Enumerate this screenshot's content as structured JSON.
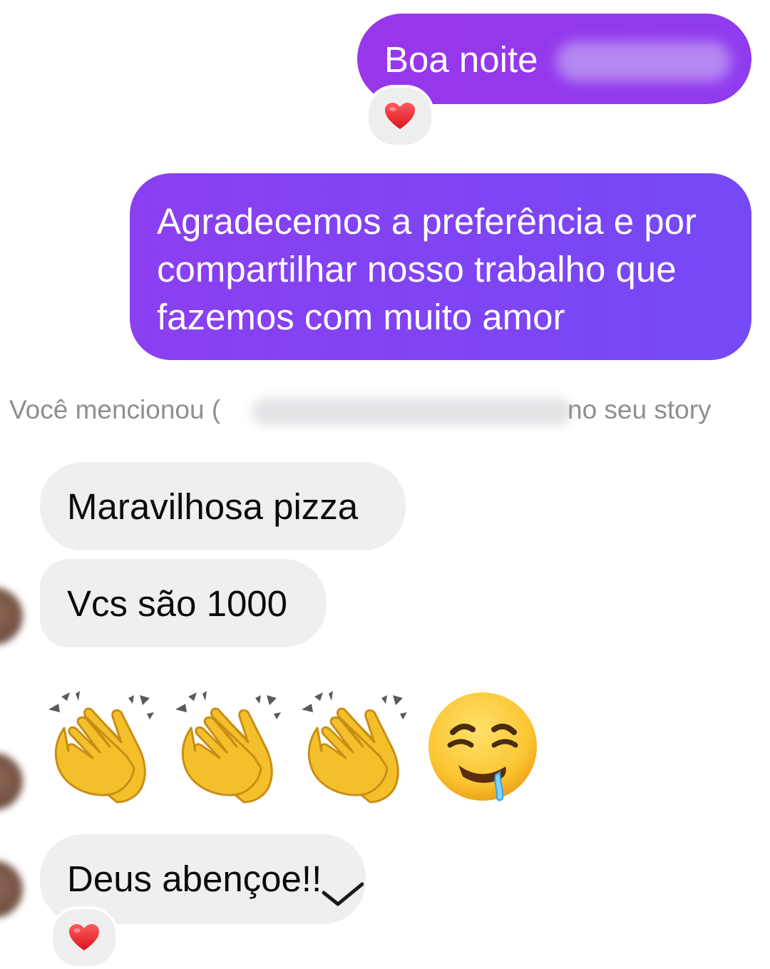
{
  "messages": {
    "outgoing_1": "Boa noite",
    "outgoing_2": "Agradecemos a preferência e por compartilhar nosso trabalho que fazemos com muito amor",
    "mention_prefix": "Você mencionou (",
    "mention_suffix": "no seu story",
    "incoming_1": "Maravilhosa pizza",
    "incoming_2": "Vcs são 1000",
    "incoming_3": "Deus abençoe!!"
  },
  "icons": {
    "reaction": "heart-icon",
    "emoji_row": [
      "clapping-hands-icon",
      "clapping-hands-icon",
      "clapping-hands-icon",
      "drooling-face-icon"
    ],
    "check": "checkmark-icon"
  },
  "colors": {
    "outgoing_bubble": "#8a3ff0",
    "incoming_bubble": "#efeff1",
    "system_text": "#8e8e93",
    "heart": "#e8232d"
  }
}
